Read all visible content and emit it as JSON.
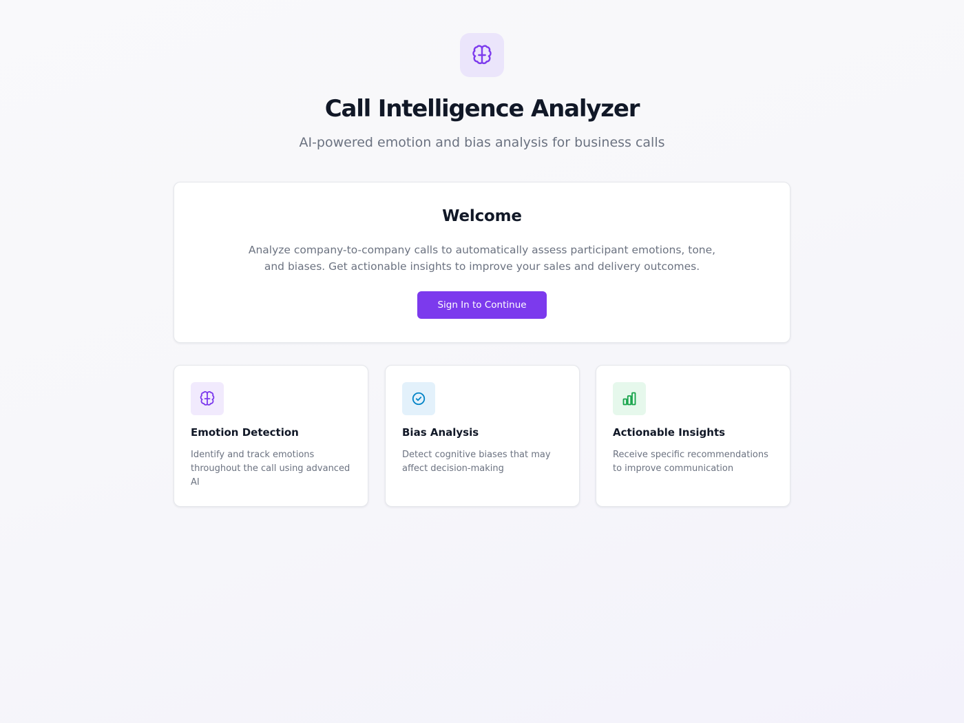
{
  "header": {
    "logo_icon": "brain-icon",
    "title": "Call Intelligence Analyzer",
    "subtitle": "AI-powered emotion and bias analysis for business calls"
  },
  "welcome": {
    "title": "Welcome",
    "description": "Analyze company-to-company calls to automatically assess participant emotions, tone, and biases. Get actionable insights to improve your sales and delivery outcomes.",
    "button_label": "Sign In to Continue"
  },
  "features": [
    {
      "icon": "brain-icon",
      "title": "Emotion Detection",
      "description": "Identify and track emotions throughout the call using advanced AI"
    },
    {
      "icon": "check-circle-icon",
      "title": "Bias Analysis",
      "description": "Detect cognitive biases that may affect decision-making"
    },
    {
      "icon": "bar-chart-icon",
      "title": "Actionable Insights",
      "description": "Receive specific recommendations to improve communication"
    }
  ],
  "colors": {
    "accent": "#7c3aed",
    "logo_bg": "#ebe5fb",
    "emotion_icon_bg": "#f1eafd",
    "bias_icon_bg": "#e3f1fb",
    "bias_icon": "#0284c7",
    "insights_icon_bg": "#e6f8ec",
    "insights_icon": "#16a34a"
  }
}
